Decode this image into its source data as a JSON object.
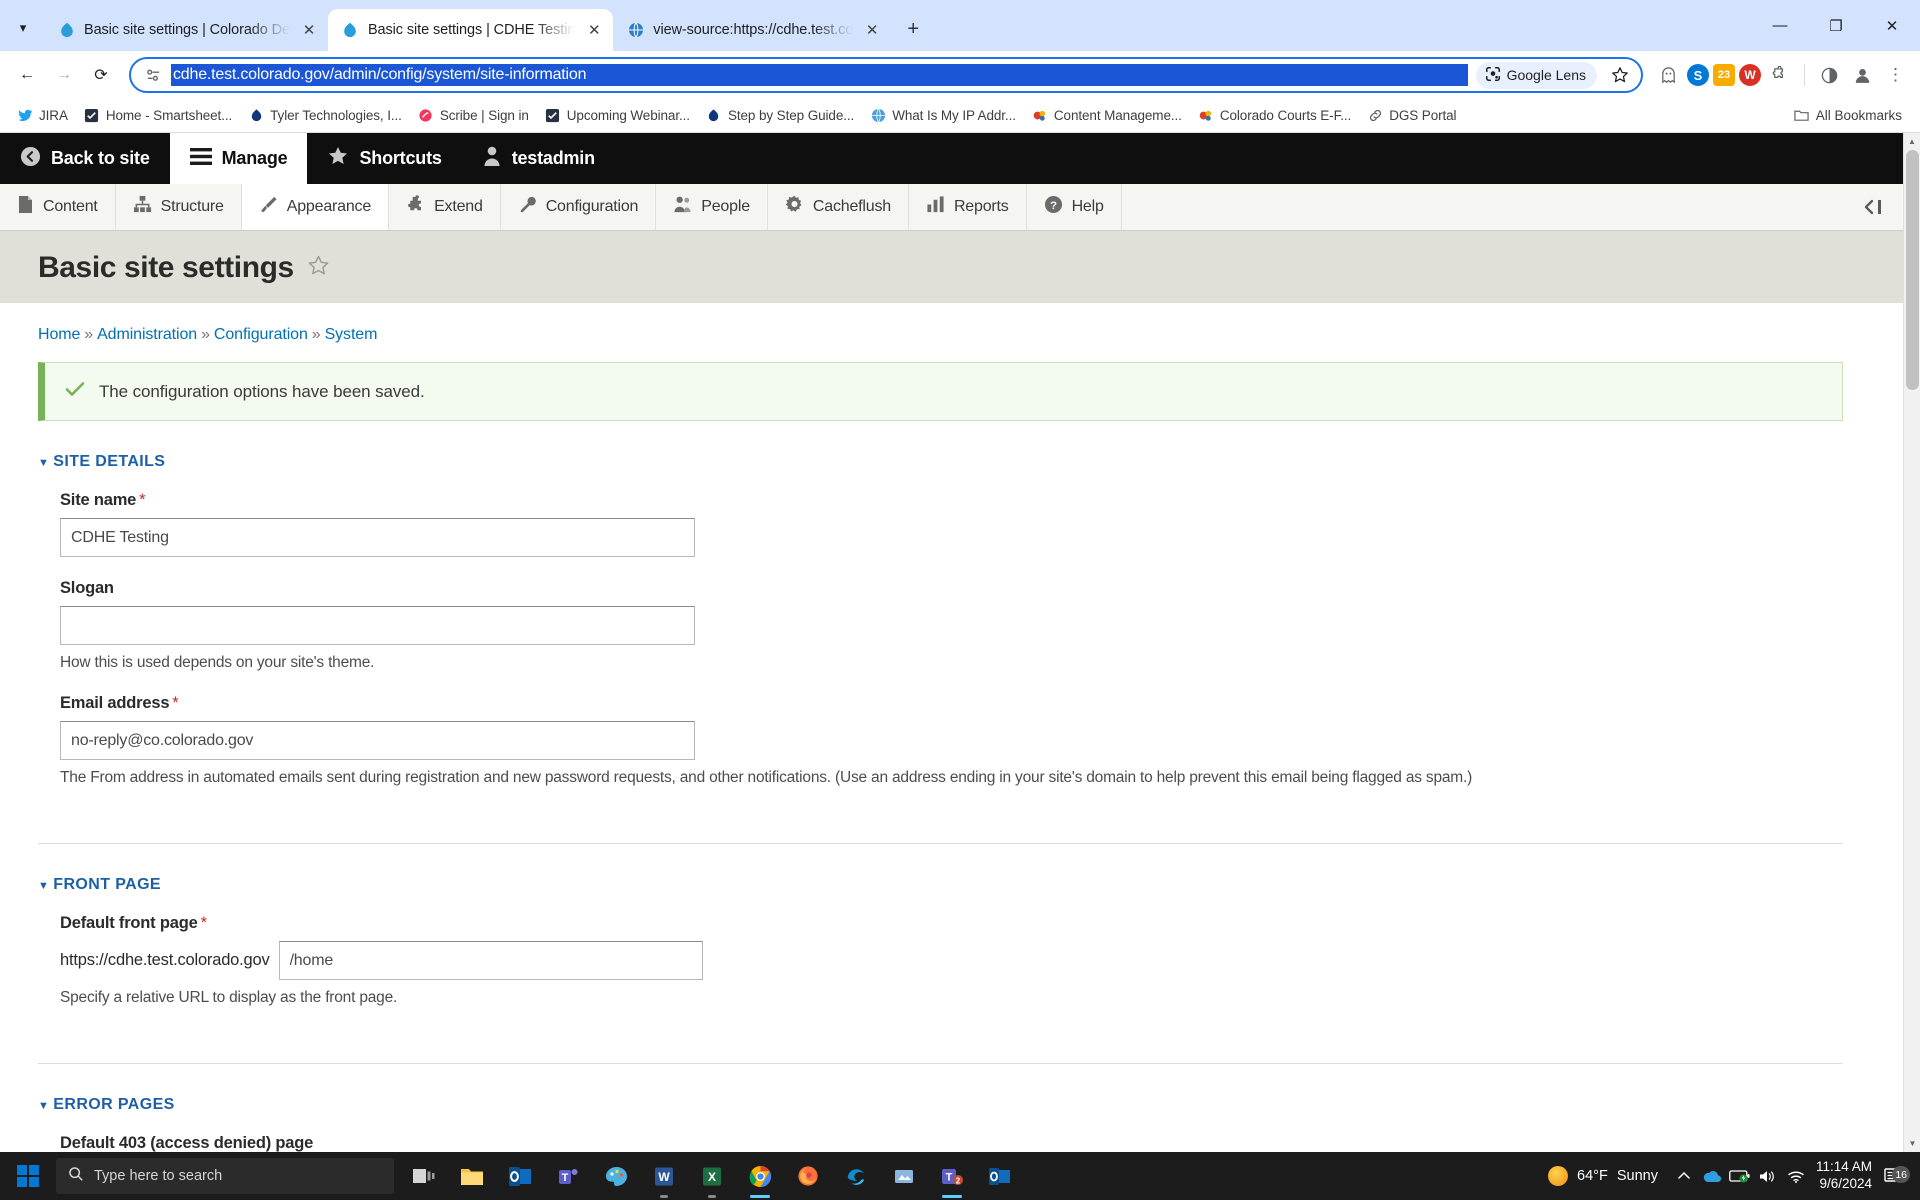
{
  "browser": {
    "tabs": [
      {
        "title": "Basic site settings | Colorado De",
        "favicon": "drupal-icon",
        "active": false
      },
      {
        "title": "Basic site settings | CDHE Testin",
        "favicon": "drupal-icon",
        "active": true
      },
      {
        "title": "view-source:https://cdhe.test.co",
        "favicon": "globe-icon",
        "active": false
      }
    ],
    "new_tab_label": "+",
    "window_controls": {
      "minimize": "—",
      "maximize": "❐",
      "close": "✕"
    },
    "nav": {
      "back": "←",
      "forward": "→",
      "reload": "⟳"
    },
    "omnibox": {
      "url": "cdhe.test.colorado.gov/admin/config/system/site-information",
      "selected": true,
      "site_info_icon": "page-info-icon",
      "lens_label": "Google Lens",
      "lens_icon": "lens-icon",
      "bookmark_icon": "star-outline-icon"
    },
    "extensions": [
      {
        "name": "ghost-extension-icon",
        "glyph": "●",
        "color": "#5f6368",
        "bg": "transparent"
      },
      {
        "name": "skype-extension-icon",
        "glyph": "S",
        "color": "#ffffff",
        "bg": "#0078d4"
      },
      {
        "name": "calendar-extension-icon",
        "glyph": "23",
        "color": "#ffffff",
        "bg": "#f9ab00"
      },
      {
        "name": "wordpress-extension-icon",
        "glyph": "W",
        "color": "#ffffff",
        "bg": "#d93025"
      },
      {
        "name": "puzzle-extensions-icon",
        "glyph": "🧩",
        "color": "#5f6368",
        "bg": "transparent"
      },
      {
        "name": "sync-profile-icon",
        "glyph": "◑",
        "color": "#5f6368",
        "bg": "transparent"
      },
      {
        "name": "profile-avatar-icon",
        "glyph": "👤",
        "color": "#5f6368",
        "bg": "transparent"
      },
      {
        "name": "chrome-menu-icon",
        "glyph": "⋮",
        "color": "#5f6368",
        "bg": "transparent"
      }
    ],
    "bookmarks": [
      {
        "label": "JIRA",
        "icon": "twitter-icon",
        "color": "#1da1f2"
      },
      {
        "label": "Home - Smartsheet...",
        "icon": "smartsheet-icon",
        "color": "#273142"
      },
      {
        "label": "Tyler Technologies, I...",
        "icon": "tyler-icon",
        "color": "#10377a"
      },
      {
        "label": "Scribe | Sign in",
        "icon": "scribe-icon",
        "color": "#f5365c"
      },
      {
        "label": "Upcoming Webinar...",
        "icon": "smartsheet-icon",
        "color": "#273142"
      },
      {
        "label": "Step by Step Guide...",
        "icon": "tyler-icon",
        "color": "#10377a"
      },
      {
        "label": "What Is My IP Addr...",
        "icon": "globe-icon",
        "color": "#2a7fc9"
      },
      {
        "label": "Content Manageme...",
        "icon": "drupal-blue-icon",
        "color": "#e03e2d"
      },
      {
        "label": "Colorado Courts E-F...",
        "icon": "drupal-blue-icon",
        "color": "#e03e2d"
      },
      {
        "label": "DGS Portal",
        "icon": "link-icon",
        "color": "#5f6368"
      }
    ],
    "all_bookmarks": {
      "label": "All Bookmarks",
      "icon": "folder-icon"
    }
  },
  "drupal": {
    "toolbar_primary": [
      {
        "label": "Back to site",
        "icon": "back-circle-icon",
        "active": false
      },
      {
        "label": "Manage",
        "icon": "hamburger-icon",
        "active": true
      },
      {
        "label": "Shortcuts",
        "icon": "star-icon",
        "active": false
      },
      {
        "label": "testadmin",
        "icon": "user-icon",
        "active": false
      }
    ],
    "toolbar_secondary": [
      {
        "label": "Content",
        "icon": "file-icon",
        "active": false
      },
      {
        "label": "Structure",
        "icon": "structure-icon",
        "active": false
      },
      {
        "label": "Appearance",
        "icon": "brush-icon",
        "active": true
      },
      {
        "label": "Extend",
        "icon": "puzzle-icon",
        "active": false
      },
      {
        "label": "Configuration",
        "icon": "wrench-icon",
        "active": false
      },
      {
        "label": "People",
        "icon": "people-icon",
        "active": false
      },
      {
        "label": "Cacheflush",
        "icon": "gear-icon",
        "active": false
      },
      {
        "label": "Reports",
        "icon": "bar-chart-icon",
        "active": false
      },
      {
        "label": "Help",
        "icon": "question-circle-icon",
        "active": false
      }
    ],
    "collapse_icon": "collapse-toolbar-icon"
  },
  "page": {
    "title": "Basic site settings",
    "title_star_icon": "star-outline-icon",
    "breadcrumb": [
      {
        "label": "Home",
        "link": true
      },
      {
        "label": "Administration",
        "link": true
      },
      {
        "label": "Configuration",
        "link": true
      },
      {
        "label": "System",
        "link": true
      }
    ],
    "breadcrumb_separator": "»",
    "status_message": {
      "text": "The configuration options have been saved.",
      "icon": "checkmark-icon",
      "accent_color": "#77b259"
    },
    "sections": {
      "site_details": {
        "legend": "SITE DETAILS",
        "caret": "▼",
        "fields": {
          "site_name": {
            "label": "Site name",
            "required": true,
            "value": "CDHE Testing",
            "description": ""
          },
          "slogan": {
            "label": "Slogan",
            "required": false,
            "value": "",
            "description": "How this is used depends on your site's theme."
          },
          "email_address": {
            "label": "Email address",
            "required": true,
            "value": "no-reply@co.colorado.gov",
            "description": "The From address in automated emails sent during registration and new password requests, and other notifications. (Use an address ending in your site's domain to help prevent this email being flagged as spam.)"
          }
        }
      },
      "front_page": {
        "legend": "FRONT PAGE",
        "caret": "▼",
        "fields": {
          "default_front_page": {
            "label": "Default front page",
            "required": true,
            "prefix": "https://cdhe.test.colorado.gov",
            "value": "/home",
            "description": "Specify a relative URL to display as the front page."
          }
        }
      },
      "error_pages": {
        "legend": "ERROR PAGES",
        "caret": "▼",
        "fields": {
          "page_403": {
            "label": "Default 403 (access denied) page",
            "required": false,
            "value": "",
            "description": ""
          }
        }
      }
    }
  },
  "taskbar": {
    "start_icon": "windows-start-icon",
    "search_placeholder": "Type here to search",
    "search_icon": "search-icon",
    "apps": [
      {
        "name": "task-view-icon",
        "glyph": "□",
        "color": "#ffffff",
        "state": ""
      },
      {
        "name": "file-explorer-icon",
        "glyph": "📁",
        "color": "#f7c948",
        "state": ""
      },
      {
        "name": "outlook-icon",
        "glyph": "O",
        "color": "#0f6cbd",
        "state": ""
      },
      {
        "name": "teams-icon",
        "glyph": "T",
        "color": "#5b5fc7",
        "state": ""
      },
      {
        "name": "paint-icon",
        "glyph": "🎨",
        "color": "#4bb3dd",
        "state": ""
      },
      {
        "name": "word-icon",
        "glyph": "W",
        "color": "#2b5797",
        "state": "open"
      },
      {
        "name": "excel-icon",
        "glyph": "X",
        "color": "#1d6f42",
        "state": "open"
      },
      {
        "name": "chrome-icon",
        "glyph": "◉",
        "color": "#4285f4",
        "state": "active"
      },
      {
        "name": "firefox-icon",
        "glyph": "◉",
        "color": "#ff7139",
        "state": ""
      },
      {
        "name": "edge-icon",
        "glyph": "◉",
        "color": "#0f8ccf",
        "state": ""
      },
      {
        "name": "snipping-tool-icon",
        "glyph": "✂",
        "color": "#8bb7dd",
        "state": ""
      },
      {
        "name": "teams-chat-icon",
        "glyph": "T",
        "color": "#5b5fc7",
        "state": "active",
        "badge": "2"
      },
      {
        "name": "outlook-new-icon",
        "glyph": "O",
        "color": "#0f6cbd",
        "state": ""
      }
    ],
    "weather": {
      "temp": "64°F",
      "condition": "Sunny",
      "icon": "sun-icon"
    },
    "tray": [
      {
        "name": "show-hidden-icons-chevron",
        "glyph": "∧"
      },
      {
        "name": "onedrive-icon",
        "glyph": "☁"
      },
      {
        "name": "battery-icon",
        "glyph": "▭"
      },
      {
        "name": "volume-icon",
        "glyph": "🔊"
      },
      {
        "name": "wifi-icon",
        "glyph": "◠"
      }
    ],
    "clock": {
      "time": "11:14 AM",
      "date": "9/6/2024"
    },
    "notifications": {
      "count": "16",
      "icon": "notification-icon"
    }
  }
}
